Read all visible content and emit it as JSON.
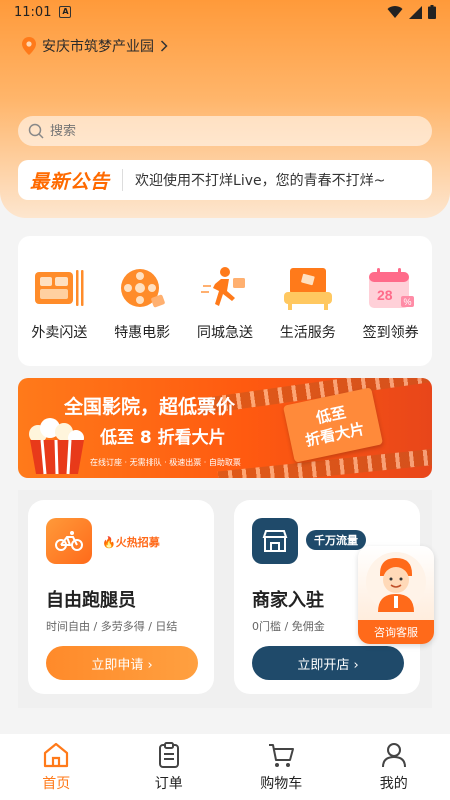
{
  "status_bar": {
    "time": "11:01",
    "notification_letter": "A"
  },
  "location": {
    "text": "安庆市筑梦产业园"
  },
  "search": {
    "placeholder": "搜索"
  },
  "notice": {
    "tag": "最新公告",
    "text": "欢迎使用不打烊Live，您的青春不打烊~"
  },
  "services": [
    {
      "label": "外卖闪送",
      "icon": "food-box-icon"
    },
    {
      "label": "特惠电影",
      "icon": "film-reel-icon"
    },
    {
      "label": "同城急送",
      "icon": "runner-icon"
    },
    {
      "label": "生活服务",
      "icon": "sofa-icon"
    },
    {
      "label": "签到领券",
      "icon": "calendar-icon"
    }
  ],
  "banner": {
    "title": "全国影院，超低票价",
    "subtitle": "低至 8 折看大片",
    "small_text": "在线订座 · 无需排队 · 极速出票 · 自助取票",
    "stamp_line1": "低至",
    "stamp_line2": "折看大片"
  },
  "cards": [
    {
      "title": "自由跑腿员",
      "badge": "🔥火热招募",
      "desc": "时间自由 / 多劳多得 / 日结",
      "button": "立即申请 ›",
      "accent": "#ff7a1a"
    },
    {
      "title": "商家入驻",
      "badge": "千万流量",
      "desc": "0门槛 / 免佣金",
      "button": "立即开店 ›",
      "accent": "#1f4a6a"
    }
  ],
  "customer_service": {
    "label": "咨询客服"
  },
  "tabs": [
    {
      "label": "首页",
      "active": true
    },
    {
      "label": "订单",
      "active": false
    },
    {
      "label": "购物车",
      "active": false
    },
    {
      "label": "我的",
      "active": false
    }
  ],
  "colors": {
    "brand": "#ff7a1a",
    "dark_accent": "#1f4a6a"
  }
}
